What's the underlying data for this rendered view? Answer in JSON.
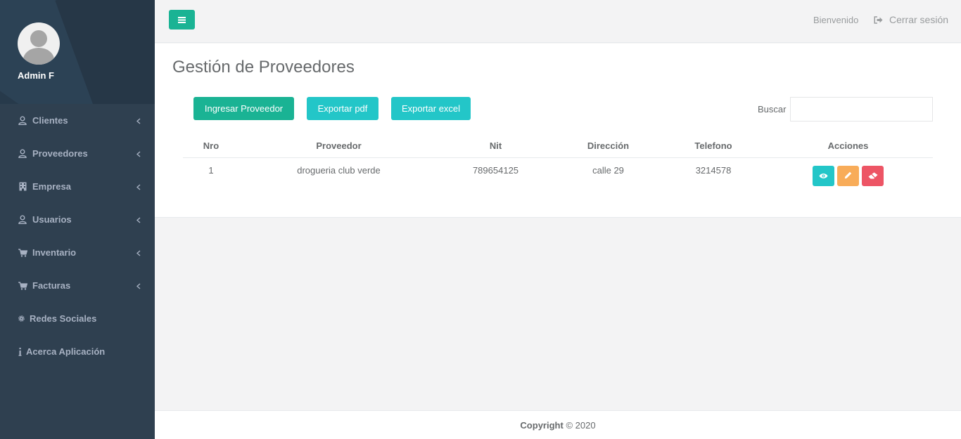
{
  "sidebar": {
    "profile_name": "Admin F",
    "items": [
      {
        "label": "Clientes",
        "icon": "user-icon",
        "has_submenu": true
      },
      {
        "label": "Proveedores",
        "icon": "user-icon",
        "has_submenu": true
      },
      {
        "label": "Empresa",
        "icon": "building-icon",
        "has_submenu": true
      },
      {
        "label": "Usuarios",
        "icon": "user-icon",
        "has_submenu": true
      },
      {
        "label": "Inventario",
        "icon": "cart-icon",
        "has_submenu": true
      },
      {
        "label": "Facturas",
        "icon": "cart-icon",
        "has_submenu": true
      },
      {
        "label": "Redes Sociales",
        "icon": "gear-icon",
        "has_submenu": false
      },
      {
        "label": "Acerca Aplicación",
        "icon": "info-icon",
        "has_submenu": false
      }
    ]
  },
  "topbar": {
    "welcome": "Bienvenido",
    "logout": "Cerrar sesión"
  },
  "main": {
    "title": "Gestión de Proveedores",
    "buttons": {
      "add": "Ingresar Proveedor",
      "pdf": "Exportar pdf",
      "excel": "Exportar excel"
    },
    "search_label": "Buscar",
    "search_value": "",
    "table": {
      "headers": [
        "Nro",
        "Proveedor",
        "Nit",
        "Dirección",
        "Telefono",
        "Acciones"
      ],
      "rows": [
        [
          "1",
          "drogueria club verde",
          "789654125",
          "calle 29",
          "3214578"
        ]
      ]
    }
  },
  "footer": {
    "label": "Copyright",
    "text": "© 2020"
  },
  "colors": {
    "sidebar": "#2f4050",
    "primary": "#1ab394",
    "info": "#23c6c8",
    "warning": "#f8ac59",
    "danger": "#ed5565"
  }
}
